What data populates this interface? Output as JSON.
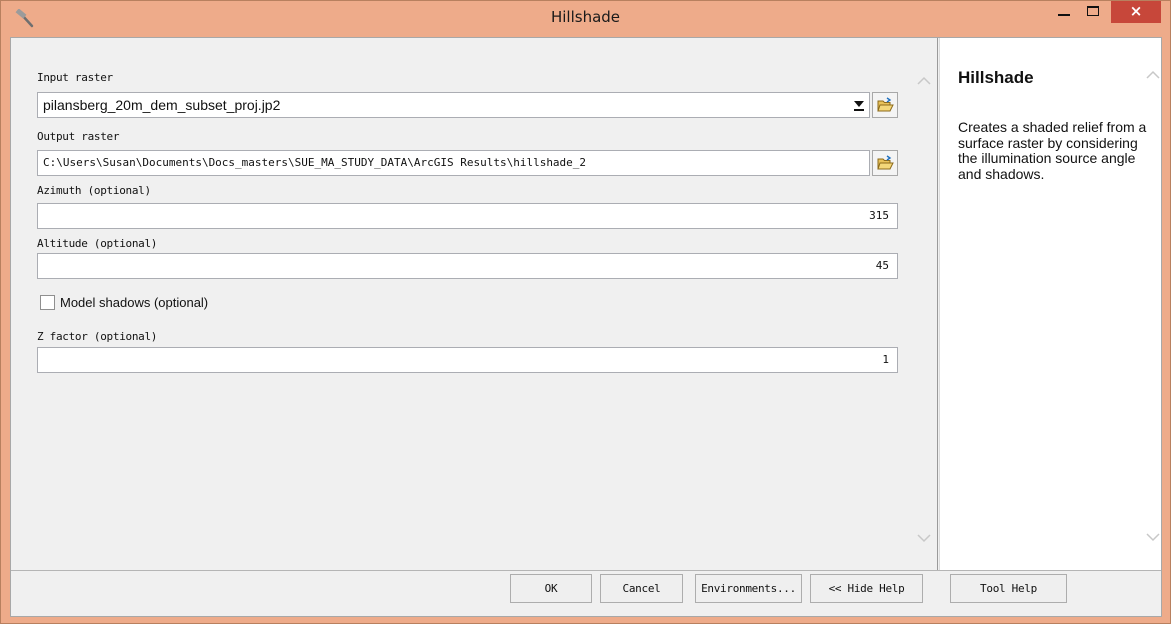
{
  "window": {
    "title": "Hillshade",
    "icon": "hammer-icon",
    "close_glyph": "×"
  },
  "form": {
    "input_raster": {
      "label": "Input raster",
      "value": "pilansberg_20m_dem_subset_proj.jp2"
    },
    "output_raster": {
      "label": "Output raster",
      "value": "C:\\Users\\Susan\\Documents\\Docs_masters\\SUE_MA_STUDY_DATA\\ArcGIS Results\\hillshade_2"
    },
    "azimuth": {
      "label": "Azimuth (optional)",
      "value": "315"
    },
    "altitude": {
      "label": "Altitude (optional)",
      "value": "45"
    },
    "model_shadows": {
      "label": "Model shadows (optional)",
      "checked": false
    },
    "z_factor": {
      "label": "Z factor (optional)",
      "value": "1"
    }
  },
  "help": {
    "title": "Hillshade",
    "description": "Creates a shaded relief from a surface raster by considering the illumination source angle and shadows."
  },
  "buttons": {
    "ok": "OK",
    "cancel": "Cancel",
    "environments": "Environments...",
    "hide_help": "<< Hide Help",
    "tool_help": "Tool Help"
  },
  "colors": {
    "titlebar": "#eeab8a",
    "close_button": "#c7473a",
    "panel": "#f0f0f0"
  }
}
